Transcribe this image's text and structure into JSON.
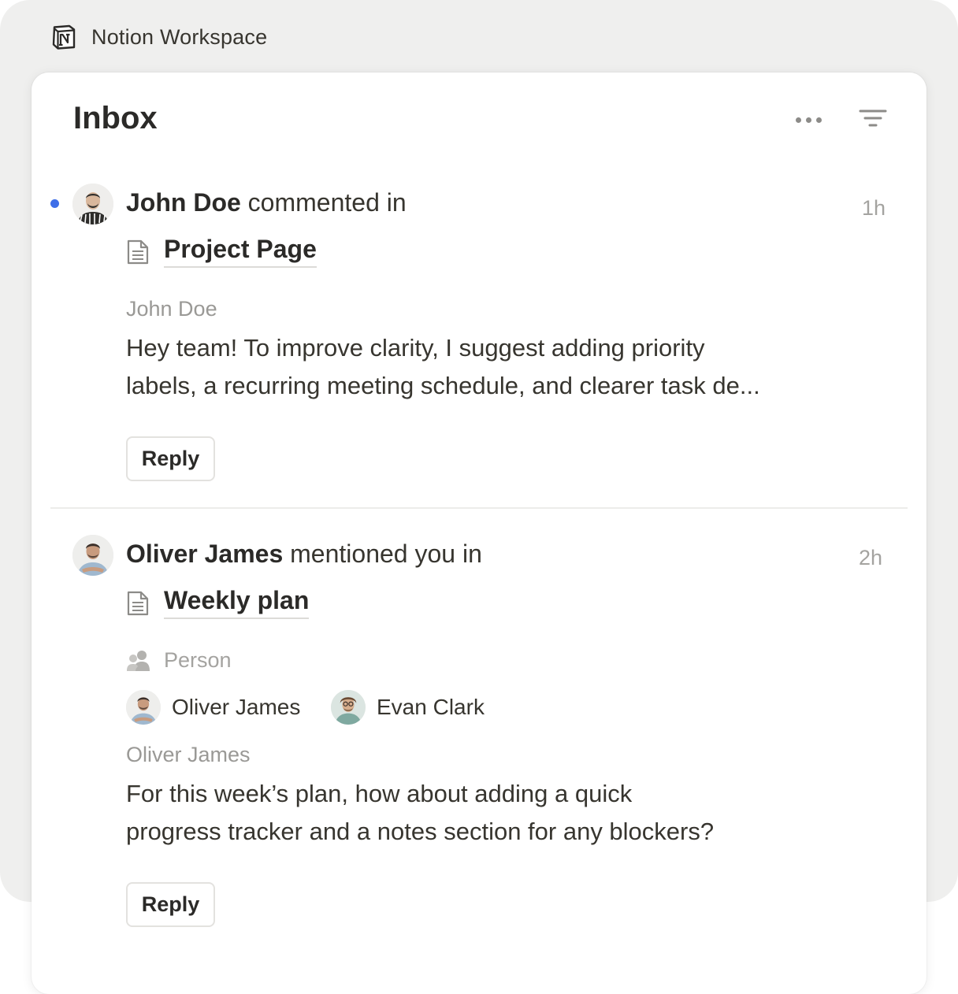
{
  "app": {
    "title": "Notion Workspace",
    "logo": "notion-logo"
  },
  "inbox": {
    "title": "Inbox",
    "more_icon": "more-horizontal-icon",
    "filter_icon": "filter-icon"
  },
  "notifications": [
    {
      "unread": true,
      "actor": "John Doe",
      "action": " commented in",
      "time": "1h",
      "page_icon": "page-icon",
      "page": "Project Page",
      "comment_author": "John Doe",
      "comment_lines": [
        "Hey team! To improve clarity, I suggest adding priority",
        "labels, a recurring meeting schedule, and clearer task de..."
      ],
      "reply_label": "Reply"
    },
    {
      "unread": false,
      "actor": "Oliver James",
      "action": " mentioned you in",
      "time": "2h",
      "page_icon": "page-icon",
      "page": "Weekly plan",
      "property": {
        "icon": "people-icon",
        "label": "Person",
        "people": [
          "Oliver James",
          "Evan Clark"
        ]
      },
      "comment_author": "Oliver James",
      "comment_lines": [
        "For this week’s plan, how about adding a quick",
        "progress tracker and a notes section for any blockers?"
      ],
      "reply_label": "Reply"
    }
  ],
  "colors": {
    "unread_dot": "#3e6ee8",
    "backdrop": "#efefee",
    "muted_text": "#a4a3a0"
  }
}
